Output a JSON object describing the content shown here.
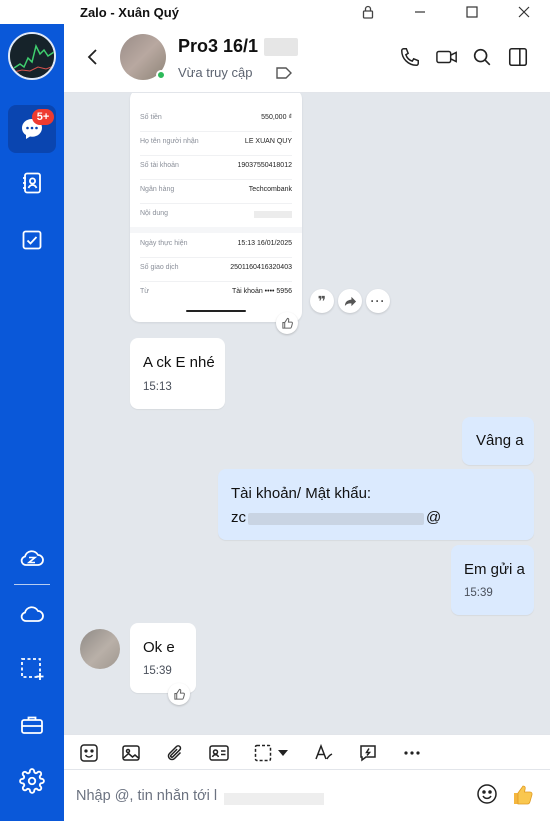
{
  "window": {
    "title": "Zalo - Xuân Quý"
  },
  "sidebar": {
    "messages_badge": "5+"
  },
  "header": {
    "name": "Pro3 16/1",
    "status": "Vừa truy cập"
  },
  "receipt": {
    "rows": [
      {
        "label": "Số tiền",
        "value": "550,000 ₫"
      },
      {
        "label": "Họ tên người nhận",
        "value": "LE XUAN QUY"
      },
      {
        "label": "Số tài khoản",
        "value": "19037550418012"
      },
      {
        "label": "Ngân hàng",
        "value": "Techcombank"
      },
      {
        "label": "Nội dung",
        "value": ""
      },
      {
        "label": "Ngày thực hiện",
        "value": "15:13 16/01/2025"
      },
      {
        "label": "Số giao dịch",
        "value": "2501160416320403"
      },
      {
        "label": "Từ",
        "value": "Tài khoản •••• 5956"
      }
    ]
  },
  "messages": [
    {
      "dir": "in",
      "text": "A ck E nhé",
      "time": "15:13"
    },
    {
      "dir": "out",
      "text": "Vâng a"
    },
    {
      "dir": "out",
      "text": "Tài khoản/ Mật khẩu:",
      "text2_prefix": "zc",
      "text2_suffix": "@"
    },
    {
      "dir": "out",
      "text": "Em gửi a",
      "time": "15:39"
    },
    {
      "dir": "in",
      "text": "Ok e",
      "time": "15:39"
    }
  ],
  "composer": {
    "placeholder": "Nhập @, tin nhắn tới l"
  },
  "colors": {
    "sidebar": "#0a58d9",
    "chat_bg": "#e3e7ec",
    "out_bubble": "#dbeafe",
    "badge": "#ee3b30",
    "online": "#2dba5a"
  }
}
